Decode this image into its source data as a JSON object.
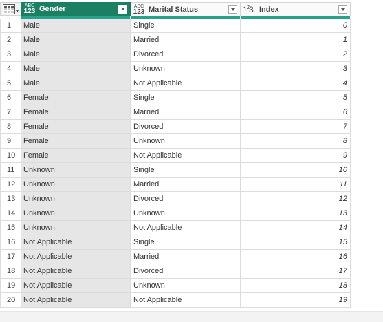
{
  "headers": {
    "gender": {
      "type_small": "ABC",
      "type_big": "123",
      "label": "Gender"
    },
    "marital_status": {
      "type_small": "ABC",
      "type_big": "123",
      "label": "Marital Status"
    },
    "index": {
      "type_label": "1²3",
      "label": "Index"
    }
  },
  "colors": {
    "selected_header": "#1a7f63",
    "quality_bar": "#26a38a",
    "selected_column_fill": "#e6e6e6"
  },
  "rows": [
    {
      "num": "1",
      "gender": "Male",
      "marital": "Single",
      "index": "0"
    },
    {
      "num": "2",
      "gender": "Male",
      "marital": "Married",
      "index": "1"
    },
    {
      "num": "3",
      "gender": "Male",
      "marital": "Divorced",
      "index": "2"
    },
    {
      "num": "4",
      "gender": "Male",
      "marital": "Unknown",
      "index": "3"
    },
    {
      "num": "5",
      "gender": "Male",
      "marital": "Not Applicable",
      "index": "4"
    },
    {
      "num": "6",
      "gender": "Female",
      "marital": "Single",
      "index": "5"
    },
    {
      "num": "7",
      "gender": "Female",
      "marital": "Married",
      "index": "6"
    },
    {
      "num": "8",
      "gender": "Female",
      "marital": "Divorced",
      "index": "7"
    },
    {
      "num": "9",
      "gender": "Female",
      "marital": "Unknown",
      "index": "8"
    },
    {
      "num": "10",
      "gender": "Female",
      "marital": "Not Applicable",
      "index": "9"
    },
    {
      "num": "11",
      "gender": "Unknown",
      "marital": "Single",
      "index": "10"
    },
    {
      "num": "12",
      "gender": "Unknown",
      "marital": "Married",
      "index": "11"
    },
    {
      "num": "13",
      "gender": "Unknown",
      "marital": "Divorced",
      "index": "12"
    },
    {
      "num": "14",
      "gender": "Unknown",
      "marital": "Unknown",
      "index": "13"
    },
    {
      "num": "15",
      "gender": "Unknown",
      "marital": "Not Applicable",
      "index": "14"
    },
    {
      "num": "16",
      "gender": "Not Applicable",
      "marital": "Single",
      "index": "15"
    },
    {
      "num": "17",
      "gender": "Not Applicable",
      "marital": "Married",
      "index": "16"
    },
    {
      "num": "18",
      "gender": "Not Applicable",
      "marital": "Divorced",
      "index": "17"
    },
    {
      "num": "19",
      "gender": "Not Applicable",
      "marital": "Unknown",
      "index": "18"
    },
    {
      "num": "20",
      "gender": "Not Applicable",
      "marital": "Not Applicable",
      "index": "19"
    }
  ]
}
